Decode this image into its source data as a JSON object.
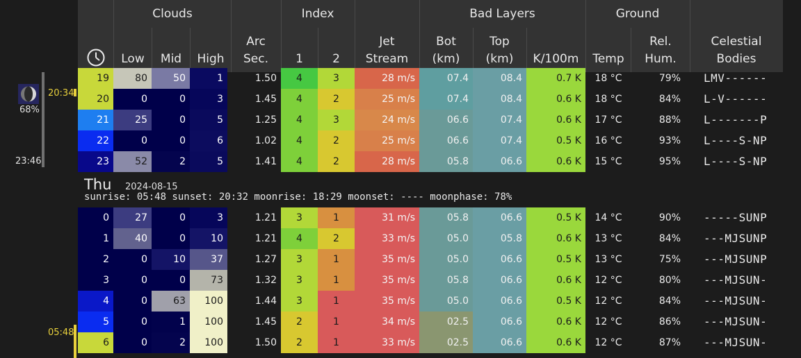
{
  "header": {
    "groups": {
      "clouds": "Clouds",
      "index": "Index",
      "bad_layers": "Bad Layers",
      "ground": "Ground"
    },
    "cols": {
      "low": "Low",
      "mid": "Mid",
      "high": "High",
      "arc1": "Arc",
      "arc2": "Sec.",
      "idx1": "1",
      "idx2": "2",
      "jet1": "Jet",
      "jet2": "Stream",
      "bot1": "Bot",
      "bot2": "(km)",
      "top1": "Top",
      "top2": "(km)",
      "k100m": "K/100m",
      "temp": "Temp",
      "rh1": "Rel.",
      "rh2": "Hum.",
      "cel1": "Celestial",
      "cel2": "Bodies"
    },
    "clock_icon": "clock-icon"
  },
  "sidebar": {
    "moon_icon": "moon-phase-icon",
    "moon_percent": "68%",
    "moonrise_marker": "20:34",
    "moonset_marker": "23:46",
    "sunrise_marker": "05:48",
    "marker_color": "#e8d03c"
  },
  "day_header": {
    "weekday": "Thu",
    "date": "2024-08-15",
    "summary": "sunrise: 05:48 sunset: 20:32 moonrise: 18:29 moonset: ---- moonphase: 78%"
  },
  "rows_day1": [
    {
      "hour": "19",
      "low": "80",
      "mid": "50",
      "high": "1",
      "arc": "1.50",
      "i1": "4",
      "i2": "3",
      "jet": "28 m/s",
      "bot": "07.4",
      "top": "08.4",
      "k": "0.7 K",
      "temp": "18 °C",
      "rh": "79%",
      "cel": "LMV------",
      "colors": {
        "hour": "#c8d83a",
        "low": "#c6c6b8",
        "mid": "#7a7aa4",
        "high": "#0a0a60",
        "i1": "#46c842",
        "i2": "#b2d838",
        "jet": "#d8664a",
        "bot": "#5f9ea0",
        "top": "#6a9ea4",
        "k": "#9ad83c"
      }
    },
    {
      "hour": "20",
      "low": "0",
      "mid": "0",
      "high": "3",
      "arc": "1.45",
      "i1": "4",
      "i2": "2",
      "jet": "25 m/s",
      "bot": "07.4",
      "top": "08.4",
      "k": "0.6 K",
      "temp": "18 °C",
      "rh": "84%",
      "cel": "L-V------",
      "colors": {
        "hour": "#c8d83a",
        "low": "#00004a",
        "mid": "#00004a",
        "high": "#06065a",
        "i1": "#7ed03a",
        "i2": "#d8c830",
        "jet": "#d8804a",
        "bot": "#5f9ea0",
        "top": "#6a9ea4",
        "k": "#9ad83c"
      }
    },
    {
      "hour": "21",
      "low": "25",
      "mid": "0",
      "high": "5",
      "arc": "1.25",
      "i1": "4",
      "i2": "3",
      "jet": "24 m/s",
      "bot": "06.6",
      "top": "07.4",
      "k": "0.6 K",
      "temp": "17 °C",
      "rh": "88%",
      "cel": "L-------P",
      "colors": {
        "hour": "#1e7ef0",
        "low": "#3c3c80",
        "mid": "#00004a",
        "high": "#0a0a5c",
        "i1": "#7ed03a",
        "i2": "#b2d838",
        "jet": "#d8884a",
        "bot": "#6a9a98",
        "top": "#6a9ea4",
        "k": "#9ad83c"
      }
    },
    {
      "hour": "22",
      "low": "0",
      "mid": "0",
      "high": "6",
      "arc": "1.02",
      "i1": "4",
      "i2": "2",
      "jet": "25 m/s",
      "bot": "06.6",
      "top": "07.4",
      "k": "0.5 K",
      "temp": "16 °C",
      "rh": "93%",
      "cel": "L----S-NP",
      "colors": {
        "hour": "#0a2cf0",
        "low": "#00004a",
        "mid": "#00004a",
        "high": "#0c0c5e",
        "i1": "#7ed03a",
        "i2": "#d8c830",
        "jet": "#d8804a",
        "bot": "#6a9a98",
        "top": "#6a9ea4",
        "k": "#9ad83c"
      }
    },
    {
      "hour": "23",
      "low": "52",
      "mid": "2",
      "high": "5",
      "arc": "1.41",
      "i1": "4",
      "i2": "2",
      "jet": "28 m/s",
      "bot": "05.8",
      "top": "06.6",
      "k": "0.6 K",
      "temp": "15 °C",
      "rh": "95%",
      "cel": "L----S-NP",
      "colors": {
        "hour": "#08088a",
        "low": "#8a8aa8",
        "mid": "#04044e",
        "high": "#0a0a5c",
        "i1": "#7ed03a",
        "i2": "#d8c830",
        "jet": "#d8664a",
        "bot": "#6a9a98",
        "top": "#6a9ea4",
        "k": "#9ad83c"
      }
    }
  ],
  "rows_day2": [
    {
      "hour": "0",
      "low": "27",
      "mid": "0",
      "high": "3",
      "arc": "1.21",
      "i1": "3",
      "i2": "1",
      "jet": "31 m/s",
      "bot": "05.8",
      "top": "06.6",
      "k": "0.5 K",
      "temp": "14 °C",
      "rh": "90%",
      "cel": "-----SUNP",
      "colors": {
        "hour": "#00004a",
        "low": "#3c3c80",
        "mid": "#00004a",
        "high": "#06065a",
        "i1": "#b2d838",
        "i2": "#d89040",
        "jet": "#d85a5a",
        "bot": "#6a9a98",
        "top": "#6a9ea4",
        "k": "#9ad83c"
      }
    },
    {
      "hour": "1",
      "low": "40",
      "mid": "0",
      "high": "10",
      "arc": "1.21",
      "i1": "4",
      "i2": "2",
      "jet": "33 m/s",
      "bot": "05.0",
      "top": "05.8",
      "k": "0.6 K",
      "temp": "13 °C",
      "rh": "84%",
      "cel": "---MJSUNP",
      "colors": {
        "hour": "#00004a",
        "low": "#62628e",
        "mid": "#00004a",
        "high": "#141466",
        "i1": "#7ed03a",
        "i2": "#d8c830",
        "jet": "#d85a5a",
        "bot": "#6a9a98",
        "top": "#6a9ea4",
        "k": "#9ad83c"
      }
    },
    {
      "hour": "2",
      "low": "0",
      "mid": "10",
      "high": "37",
      "arc": "1.27",
      "i1": "3",
      "i2": "1",
      "jet": "35 m/s",
      "bot": "05.0",
      "top": "06.6",
      "k": "0.5 K",
      "temp": "13 °C",
      "rh": "75%",
      "cel": "---MJSUNP",
      "colors": {
        "hour": "#00004a",
        "low": "#00004a",
        "mid": "#141466",
        "high": "#56568a",
        "i1": "#b2d838",
        "i2": "#d89040",
        "jet": "#d85a5a",
        "bot": "#6a9a98",
        "top": "#6a9ea4",
        "k": "#9ad83c"
      }
    },
    {
      "hour": "3",
      "low": "0",
      "mid": "0",
      "high": "73",
      "arc": "1.32",
      "i1": "3",
      "i2": "1",
      "jet": "35 m/s",
      "bot": "05.8",
      "top": "06.6",
      "k": "0.6 K",
      "temp": "12 °C",
      "rh": "80%",
      "cel": "---MJSUN-",
      "colors": {
        "hour": "#00004a",
        "low": "#00004a",
        "mid": "#00004a",
        "high": "#b4b4aa",
        "i1": "#b2d838",
        "i2": "#d89040",
        "jet": "#d85a5a",
        "bot": "#6a9a98",
        "top": "#6a9ea4",
        "k": "#9ad83c"
      }
    },
    {
      "hour": "4",
      "low": "0",
      "mid": "63",
      "high": "100",
      "arc": "1.44",
      "i1": "3",
      "i2": "1",
      "jet": "35 m/s",
      "bot": "05.0",
      "top": "06.6",
      "k": "0.5 K",
      "temp": "12 °C",
      "rh": "84%",
      "cel": "---MJSUN-",
      "colors": {
        "hour": "#0a18c8",
        "low": "#00004a",
        "mid": "#a0a0aa",
        "high": "#f0f0c8",
        "i1": "#b2d838",
        "i2": "#d85a5a",
        "jet": "#d85a5a",
        "bot": "#6a9a98",
        "top": "#6a9ea4",
        "k": "#9ad83c"
      }
    },
    {
      "hour": "5",
      "low": "0",
      "mid": "1",
      "high": "100",
      "arc": "1.45",
      "i1": "2",
      "i2": "1",
      "jet": "34 m/s",
      "bot": "02.5",
      "top": "06.6",
      "k": "0.6 K",
      "temp": "12 °C",
      "rh": "86%",
      "cel": "---MJSUN-",
      "colors": {
        "hour": "#0a2cf0",
        "low": "#00004a",
        "mid": "#02024c",
        "high": "#f0f0c8",
        "i1": "#d8c830",
        "i2": "#d85a5a",
        "jet": "#d85a5a",
        "bot": "#8a9670",
        "top": "#6a9ea4",
        "k": "#9ad83c"
      }
    },
    {
      "hour": "6",
      "low": "0",
      "mid": "2",
      "high": "100",
      "arc": "1.50",
      "i1": "2",
      "i2": "1",
      "jet": "33 m/s",
      "bot": "02.5",
      "top": "06.6",
      "k": "0.6 K",
      "temp": "12 °C",
      "rh": "87%",
      "cel": "---MJSUN-",
      "colors": {
        "hour": "#c8d83a",
        "low": "#00004a",
        "mid": "#04044e",
        "high": "#f0f0c8",
        "i1": "#d8c830",
        "i2": "#d85a5a",
        "jet": "#d85a5a",
        "bot": "#8a9670",
        "top": "#6a9ea4",
        "k": "#9ad83c"
      }
    }
  ]
}
